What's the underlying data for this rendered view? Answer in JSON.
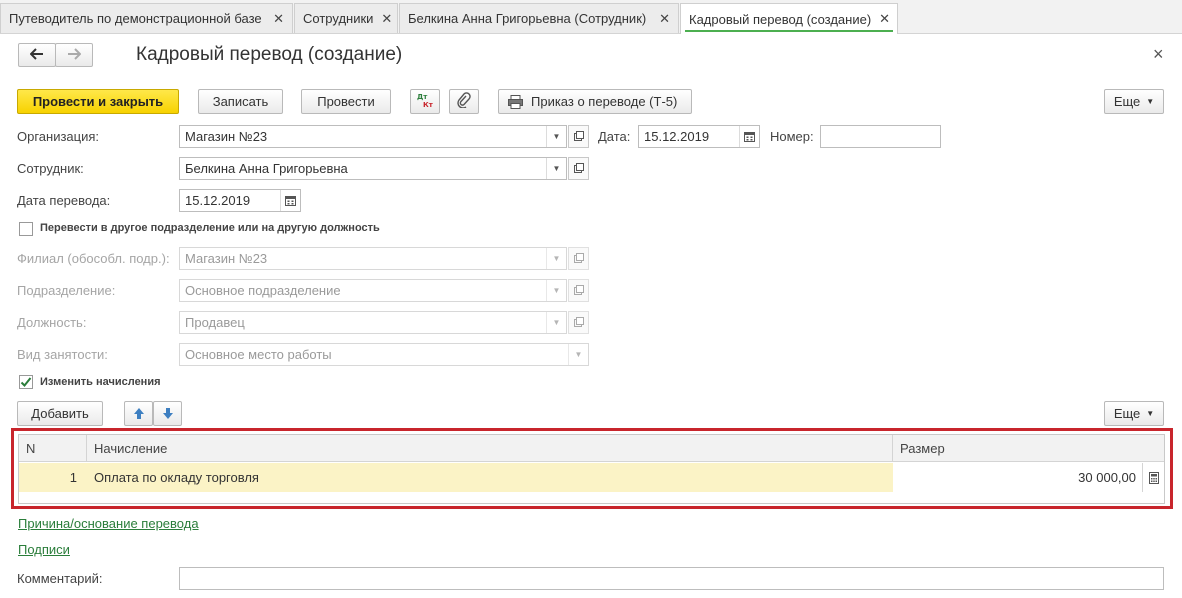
{
  "tabs": [
    {
      "label": "Путеводитель по демонстрационной базе"
    },
    {
      "label": "Сотрудники"
    },
    {
      "label": "Белкина Анна Григорьевна (Сотрудник)"
    },
    {
      "label": "Кадровый перевод (создание)"
    }
  ],
  "window": {
    "title": "Кадровый перевод (создание)",
    "close": "×",
    "back": "🡐",
    "forward": "🡒"
  },
  "toolbar": {
    "post_close": "Провести и закрыть",
    "save": "Записать",
    "post": "Провести",
    "dtkt": "ДтКт",
    "print_order": "Приказ о переводе (Т-5)",
    "more": "Еще"
  },
  "form": {
    "org_label": "Организация:",
    "org_value": "Магазин №23",
    "date_label": "Дата:",
    "date_value": "15.12.2019",
    "number_label": "Номер:",
    "number_value": "",
    "employee_label": "Сотрудник:",
    "employee_value": "Белкина Анна Григорьевна",
    "transfer_date_label": "Дата перевода:",
    "transfer_date_value": "15.12.2019",
    "transfer_checkbox_label": "Перевести в другое подразделение или на другую должность",
    "transfer_checked": false,
    "branch_label": "Филиал (обособл. подр.):",
    "branch_value": "Магазин №23",
    "department_label": "Подразделение:",
    "department_value": "Основное подразделение",
    "position_label": "Должность:",
    "position_value": "Продавец",
    "employment_label": "Вид занятости:",
    "employment_value": "Основное место работы",
    "accruals_checkbox_label": "Изменить начисления",
    "accruals_checked": true
  },
  "table_toolbar": {
    "add": "Добавить",
    "more": "Еще"
  },
  "table": {
    "columns": [
      "N",
      "Начисление",
      "Размер"
    ],
    "rows": [
      {
        "n": "1",
        "accrual": "Оплата по окладу торговля",
        "amount": "30 000,00"
      }
    ]
  },
  "links": {
    "reason": "Причина/основание перевода",
    "signatures": "Подписи"
  },
  "comment": {
    "label": "Комментарий:",
    "value": ""
  },
  "colors": {
    "primary_button": "#f7d200",
    "highlight_frame": "#c8252c",
    "row_selected": "#fbf3c6",
    "link": "#2a7d3a",
    "active_tab_marker": "#4caf50"
  }
}
